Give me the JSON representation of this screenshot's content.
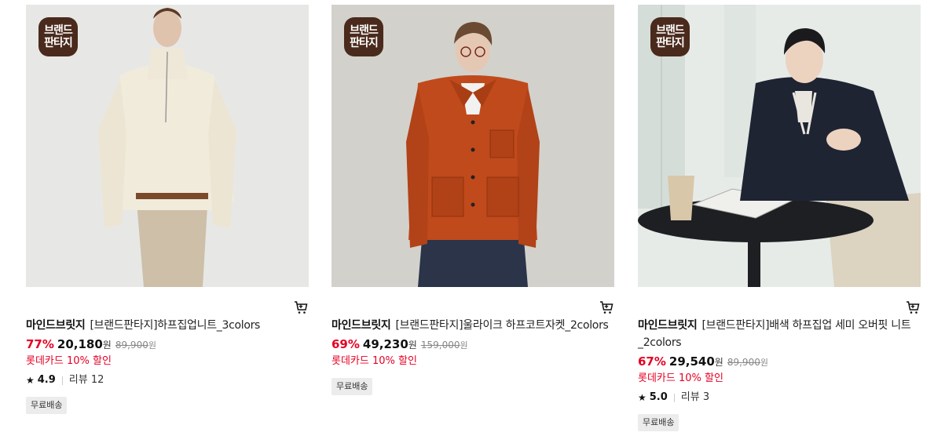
{
  "badge": {
    "line1": "브랜드",
    "line2": "판타지"
  },
  "products": [
    {
      "brand": "마인드브릿지",
      "name": "[브랜드판타지]하프집업니트_3colors",
      "discount": "77%",
      "price": "20,180",
      "currency": "원",
      "original_price": "89,900",
      "original_currency": "원",
      "card_promo": "롯데카드 10% 할인",
      "rating": "4.9",
      "review_label": "리뷰 12",
      "shipping_tag": "무료배송",
      "image_icon": "product-photo-cream-halfzip-knit"
    },
    {
      "brand": "마인드브릿지",
      "name": "[브랜드판타지]울라이크 하프코트자켓_2colors",
      "discount": "69%",
      "price": "49,230",
      "currency": "원",
      "original_price": "159,000",
      "original_currency": "원",
      "card_promo": "롯데카드 10% 할인",
      "shipping_tag": "무료배송",
      "image_icon": "product-photo-orange-wool-jacket"
    },
    {
      "brand": "마인드브릿지",
      "name": "[브랜드판타지]배색 하프집업 세미 오버핏 니트_2colors",
      "discount": "67%",
      "price": "29,540",
      "currency": "원",
      "original_price": "89,900",
      "original_currency": "원",
      "card_promo": "롯데카드 10% 할인",
      "rating": "5.0",
      "review_label": "리뷰 3",
      "shipping_tag": "무료배송",
      "image_icon": "product-photo-navy-halfzip-knit"
    }
  ],
  "icons": {
    "cart": "cart-icon",
    "star": "star-icon"
  },
  "colors": {
    "discount": "#e60023",
    "badge_bg": "#4a2a1c",
    "tag_bg": "#ececec"
  }
}
